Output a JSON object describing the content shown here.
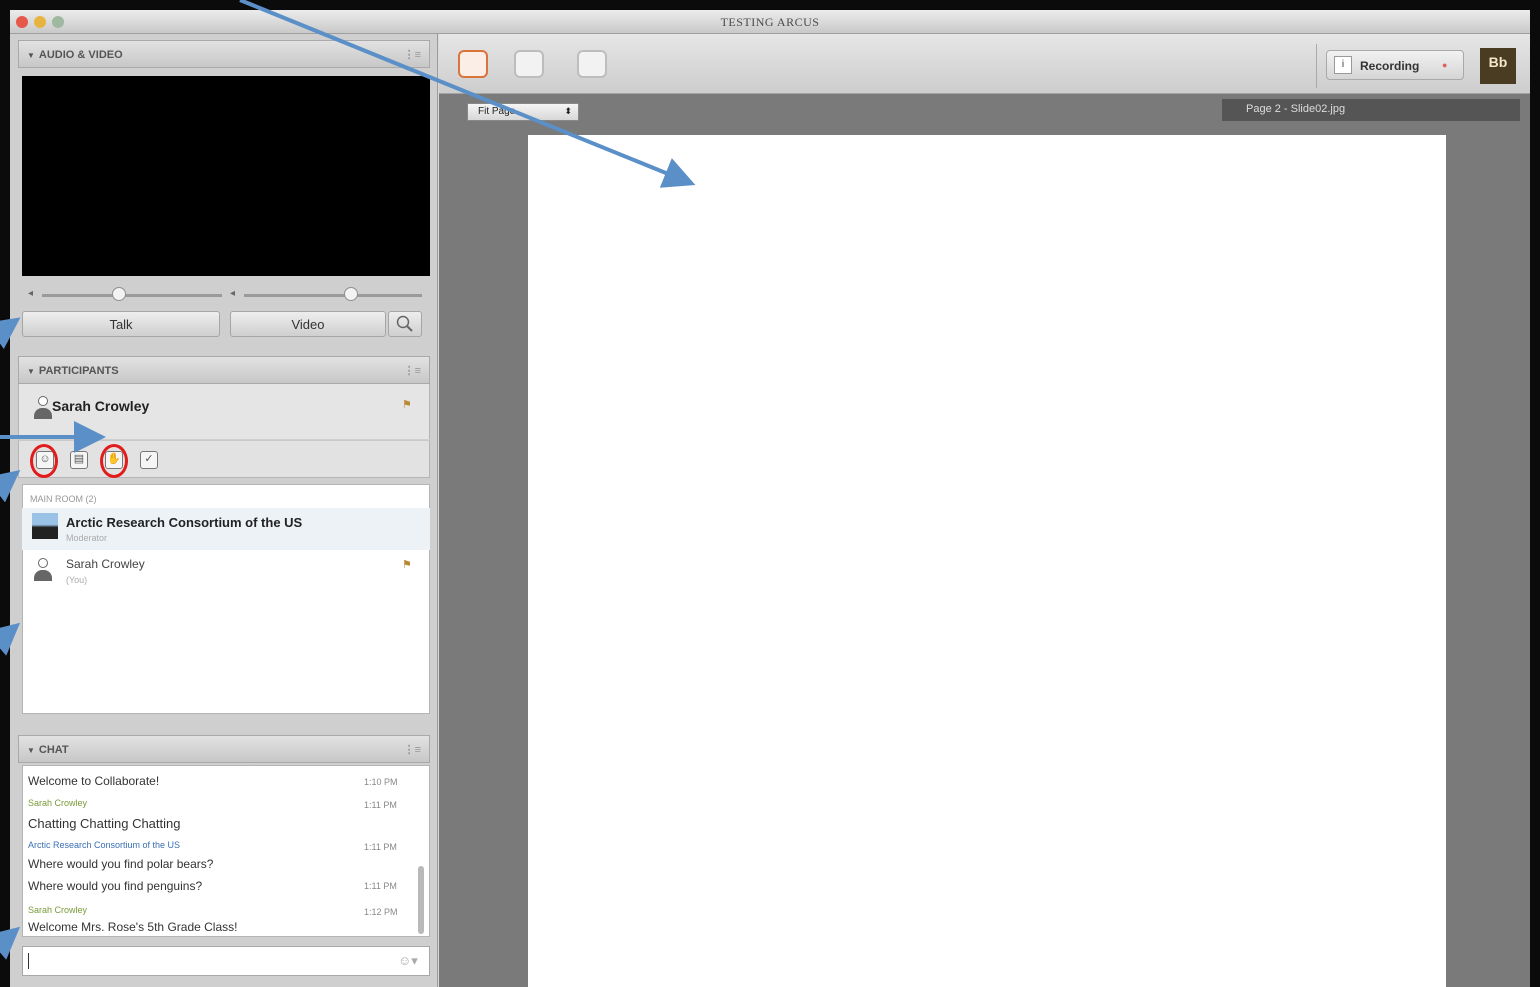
{
  "window": {
    "title": "TESTING ARCUS"
  },
  "audio_video": {
    "header": "AUDIO & VIDEO",
    "talk_label": "Talk",
    "video_label": "Video"
  },
  "participants": {
    "header": "PARTICIPANTS",
    "me": {
      "name": "Sarah Crowley"
    },
    "room_label": "MAIN ROOM (2)",
    "list": [
      {
        "name": "Arctic Research Consortium of the US",
        "role": "Moderator"
      },
      {
        "name": "Sarah Crowley",
        "role": "(You)"
      }
    ]
  },
  "chat": {
    "header": "CHAT",
    "messages": [
      {
        "sender": "",
        "text": "Welcome to Collaborate!",
        "time": "1:10 PM"
      },
      {
        "sender": "Sarah Crowley",
        "text": "Chatting Chatting Chatting",
        "time": "1:11 PM"
      },
      {
        "sender": "Arctic Research Consortium of the US",
        "text": "Where would you find polar bears?",
        "time": "1:11 PM"
      },
      {
        "sender": "",
        "text": "Where would you find penguins?",
        "time": "1:11 PM"
      },
      {
        "sender": "Sarah Crowley",
        "text": "Welcome Mrs. Rose's 5th Grade Class!",
        "time": "1:12 PM"
      }
    ],
    "input_value": ""
  },
  "toolbar": {
    "recording_label": "Recording",
    "logo_text": "Bb"
  },
  "whiteboard": {
    "zoom_select": "Fit Page",
    "page_label": "Page 2 - Slide02.jpg"
  },
  "colors": {
    "accent_orange": "#d9743a",
    "highlight_red": "#e21b1b",
    "annotation_arrow": "#5b8fc7",
    "sender_green": "#7a9a3a",
    "sender_blue": "#3a6fb5"
  }
}
